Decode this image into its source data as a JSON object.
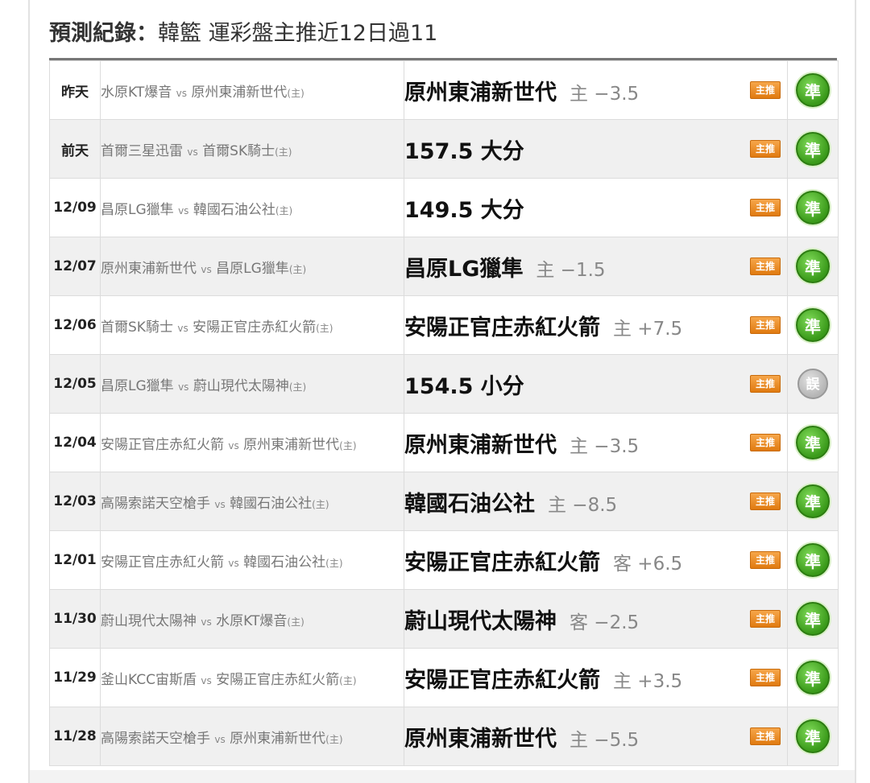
{
  "header": {
    "title_main": "預測紀錄：",
    "title_sub": "韓籃 運彩盤主推近12日過11"
  },
  "labels": {
    "vs": "vs",
    "home_marker": "(主)",
    "tag": "主推"
  },
  "colors": {
    "win_badge": "#3a9a1a",
    "push_badge": "#b5b5b5",
    "tag": "#e07a10"
  },
  "records": [
    {
      "date": "昨天",
      "away": "水原KT爆音",
      "home": "原州東浦新世代",
      "pick": "原州東浦新世代",
      "odds": "主 −3.5",
      "result": "準",
      "result_type": "win"
    },
    {
      "date": "前天",
      "away": "首爾三星迅雷",
      "home": "首爾SK騎士",
      "pick": "157.5 大分",
      "odds": "",
      "result": "準",
      "result_type": "win"
    },
    {
      "date": "12/09",
      "away": "昌原LG獵隼",
      "home": "韓國石油公社",
      "pick": "149.5 大分",
      "odds": "",
      "result": "準",
      "result_type": "win"
    },
    {
      "date": "12/07",
      "away": "原州東浦新世代",
      "home": "昌原LG獵隼",
      "pick": "昌原LG獵隼",
      "odds": "主 −1.5",
      "result": "準",
      "result_type": "win"
    },
    {
      "date": "12/06",
      "away": "首爾SK騎士",
      "home": "安陽正官庄赤紅火箭",
      "pick": "安陽正官庄赤紅火箭",
      "odds": "主 +7.5",
      "result": "準",
      "result_type": "win"
    },
    {
      "date": "12/05",
      "away": "昌原LG獵隼",
      "home": "蔚山現代太陽神",
      "pick": "154.5 小分",
      "odds": "",
      "result": "誤",
      "result_type": "push"
    },
    {
      "date": "12/04",
      "away": "安陽正官庄赤紅火箭",
      "home": "原州東浦新世代",
      "pick": "原州東浦新世代",
      "odds": "主 −3.5",
      "result": "準",
      "result_type": "win"
    },
    {
      "date": "12/03",
      "away": "高陽索諾天空槍手",
      "home": "韓國石油公社",
      "pick": "韓國石油公社",
      "odds": "主 −8.5",
      "result": "準",
      "result_type": "win"
    },
    {
      "date": "12/01",
      "away": "安陽正官庄赤紅火箭",
      "home": "韓國石油公社",
      "pick": "安陽正官庄赤紅火箭",
      "odds": "客 +6.5",
      "result": "準",
      "result_type": "win"
    },
    {
      "date": "11/30",
      "away": "蔚山現代太陽神",
      "home": "水原KT爆音",
      "pick": "蔚山現代太陽神",
      "odds": "客 −2.5",
      "result": "準",
      "result_type": "win"
    },
    {
      "date": "11/29",
      "away": "釜山KCC宙斯盾",
      "home": "安陽正官庄赤紅火箭",
      "pick": "安陽正官庄赤紅火箭",
      "odds": "主 +3.5",
      "result": "準",
      "result_type": "win"
    },
    {
      "date": "11/28",
      "away": "高陽索諾天空槍手",
      "home": "原州東浦新世代",
      "pick": "原州東浦新世代",
      "odds": "主 −5.5",
      "result": "準",
      "result_type": "win"
    }
  ]
}
